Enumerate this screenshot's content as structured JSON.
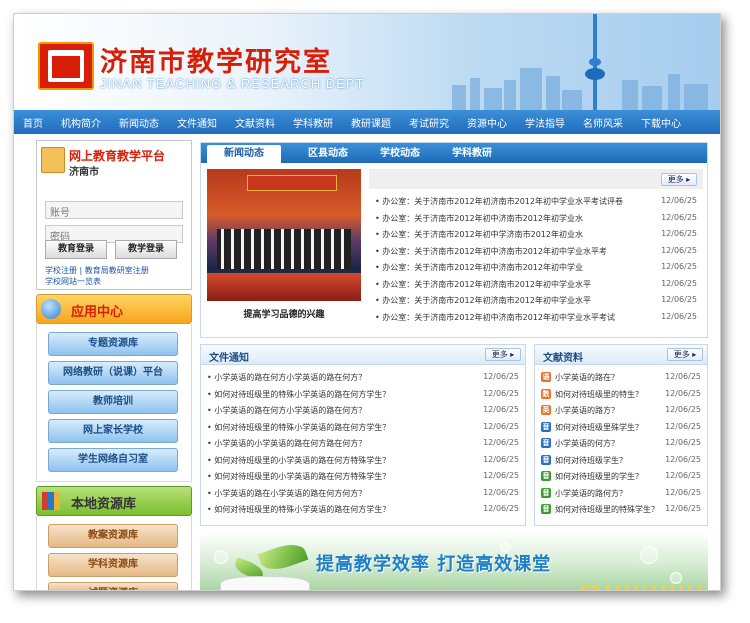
{
  "header": {
    "title": "济南市教学研究室",
    "subtitle": "JINAN TEACHING & RESEARCH DEPT"
  },
  "nav": [
    "首页",
    "机构简介",
    "新闻动态",
    "文件通知",
    "文献资料",
    "学科教研",
    "教研课题",
    "考试研究",
    "资源中心",
    "学法指导",
    "名师风采",
    "下载中心"
  ],
  "login": {
    "title": "网上教育教学平台",
    "city": "济南市",
    "account_placeholder": "账号",
    "password_placeholder": "密码",
    "btn_edu": "教育登录",
    "btn_teach": "教学登录",
    "link1": "学校注册",
    "link_sep": "|",
    "link2": "教育局教研室注册",
    "link3": "学校网站一览表"
  },
  "app_center": {
    "title": "应用中心",
    "items": [
      "专题资源库",
      "网络教研（说课）平台",
      "教师培训",
      "网上家长学校",
      "学生网络自习室"
    ]
  },
  "local_resources": {
    "title": "本地资源库",
    "items": [
      "教案资源库",
      "学科资源库",
      "试题资源库"
    ]
  },
  "news": {
    "tabs": [
      "新闻动态",
      "区县动态",
      "学校动态",
      "学科教研"
    ],
    "photo_caption": "提高学习品德的兴趣",
    "more": "更多",
    "items": [
      {
        "title": "• 办公室：关于济南市2012年初济南市2012年初中学业水平考试评卷",
        "date": "12/06/25"
      },
      {
        "title": "• 办公室：关于济南市2012年初中济南市2012年初学业水",
        "date": "12/06/25"
      },
      {
        "title": "• 办公室：关于济南市2012年初中学济南市2012年初业水",
        "date": "12/06/25"
      },
      {
        "title": "• 办公室：关于济南市2012年初中济南市2012年初中学业水平考",
        "date": "12/06/25"
      },
      {
        "title": "• 办公室：关于济南市2012年初中济南市2012年初中学业",
        "date": "12/06/25"
      },
      {
        "title": "• 办公室：关于济南市2012年初济南市2012年初中学业水平",
        "date": "12/06/25"
      },
      {
        "title": "• 办公室：关于济南市2012年初济南市2012年初中学业水平",
        "date": "12/06/25"
      },
      {
        "title": "• 办公室：关于济南市2012年初中济南市2012年初中学业水平考试",
        "date": "12/06/25"
      }
    ]
  },
  "notices": {
    "title": "文件通知",
    "more": "更多",
    "items": [
      {
        "title": "• 小学英语的路在何方小学英语的路在何方？",
        "date": "12/06/25"
      },
      {
        "title": "• 如何对待班级里的特殊小学英语的路在何方学生？",
        "date": "12/06/25"
      },
      {
        "title": "• 小学英语的路在何方小学英语的路在何方？",
        "date": "12/06/25"
      },
      {
        "title": "• 如何对待班级里的特殊小学英语的路在何方学生？",
        "date": "12/06/25"
      },
      {
        "title": "• 小学英语的小学英语的路在何方路在何方？",
        "date": "12/06/25"
      },
      {
        "title": "• 如何对待班级里的小学英语的路在何方特殊学生？",
        "date": "12/06/25"
      },
      {
        "title": "• 如何对待班级里的小学英语的路在何方特殊学生？",
        "date": "12/06/25"
      },
      {
        "title": "• 小学英语的路在小学英语的路在何方何方？",
        "date": "12/06/25"
      },
      {
        "title": "• 如何对待班级里的特殊小学英语的路在何方学生？",
        "date": "12/06/25"
      }
    ]
  },
  "literature": {
    "title": "文献资料",
    "more": "更多",
    "items": [
      {
        "badge": "语",
        "color": "#e8742a",
        "title": "小学英语的路在？",
        "date": "12/06/25"
      },
      {
        "badge": "数",
        "color": "#e8742a",
        "title": "如何对待班级里的特生？",
        "date": "12/06/25"
      },
      {
        "badge": "英",
        "color": "#e8742a",
        "title": "小学英语的路方？",
        "date": "12/06/25"
      },
      {
        "badge": "音",
        "color": "#2a6fc4",
        "title": "如何对待班级里殊学生？",
        "date": "12/06/25"
      },
      {
        "badge": "音",
        "color": "#2a6fc4",
        "title": "小学英语的何方？",
        "date": "12/06/25"
      },
      {
        "badge": "音",
        "color": "#2a6fc4",
        "title": "如何对待班级学生？",
        "date": "12/06/25"
      },
      {
        "badge": "音",
        "color": "#3f9a2e",
        "title": "如何对待班级里的学生？",
        "date": "12/06/25"
      },
      {
        "badge": "音",
        "color": "#3f9a2e",
        "title": "小学英语的路何方？",
        "date": "12/06/25"
      },
      {
        "badge": "音",
        "color": "#3f9a2e",
        "title": "如何对待班级里的特殊学生？",
        "date": "12/06/25"
      }
    ]
  },
  "banner": {
    "slogan": "提高教学效率  打造高效课堂"
  }
}
